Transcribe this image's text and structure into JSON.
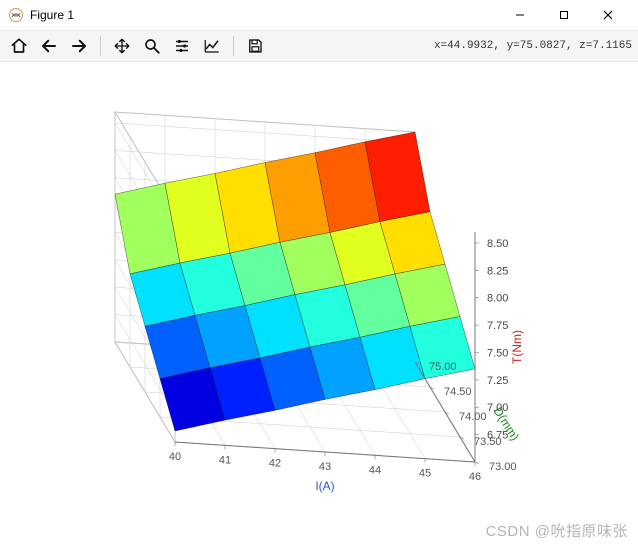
{
  "window": {
    "title": "Figure 1",
    "min_tooltip": "Minimize",
    "max_tooltip": "Maximize",
    "close_tooltip": "Close"
  },
  "toolbar": {
    "home": "Home",
    "back": "Back",
    "forward": "Forward",
    "pan": "Pan",
    "zoom": "Zoom",
    "subplots": "Configure subplots",
    "edit": "Edit axis",
    "save": "Save the figure",
    "coord_readout": "x=44.9932, y=75.0827, z=7.1165"
  },
  "watermark": "CSDN @吮指原味张",
  "chart_data": {
    "type": "surface3d",
    "xlabel": "I(A)",
    "ylabel": "D(mm)",
    "zlabel": "T(Nm)",
    "x": [
      40,
      41,
      42,
      43,
      44,
      45,
      46
    ],
    "x_ticks": [
      40,
      41,
      42,
      43,
      44,
      45,
      46
    ],
    "y": [
      73.0,
      73.5,
      74.0,
      74.5,
      75.0
    ],
    "y_ticks": [
      73.0,
      73.5,
      74.0,
      74.5,
      75.0
    ],
    "z_ticks": [
      6.75,
      7.0,
      7.25,
      7.5,
      7.75,
      8.0,
      8.25,
      8.5
    ],
    "zlim": [
      6.5,
      8.6
    ],
    "z": [
      [
        6.6,
        6.73,
        6.85,
        6.98,
        7.1,
        7.23,
        7.35
      ],
      [
        6.85,
        6.98,
        7.1,
        7.23,
        7.35,
        7.48,
        7.6
      ],
      [
        7.1,
        7.23,
        7.35,
        7.48,
        7.6,
        7.73,
        7.85
      ],
      [
        7.35,
        7.48,
        7.6,
        7.73,
        7.85,
        7.98,
        8.1
      ],
      [
        7.85,
        7.98,
        8.1,
        8.23,
        8.35,
        8.48,
        8.6
      ]
    ],
    "colormap": "jet"
  }
}
